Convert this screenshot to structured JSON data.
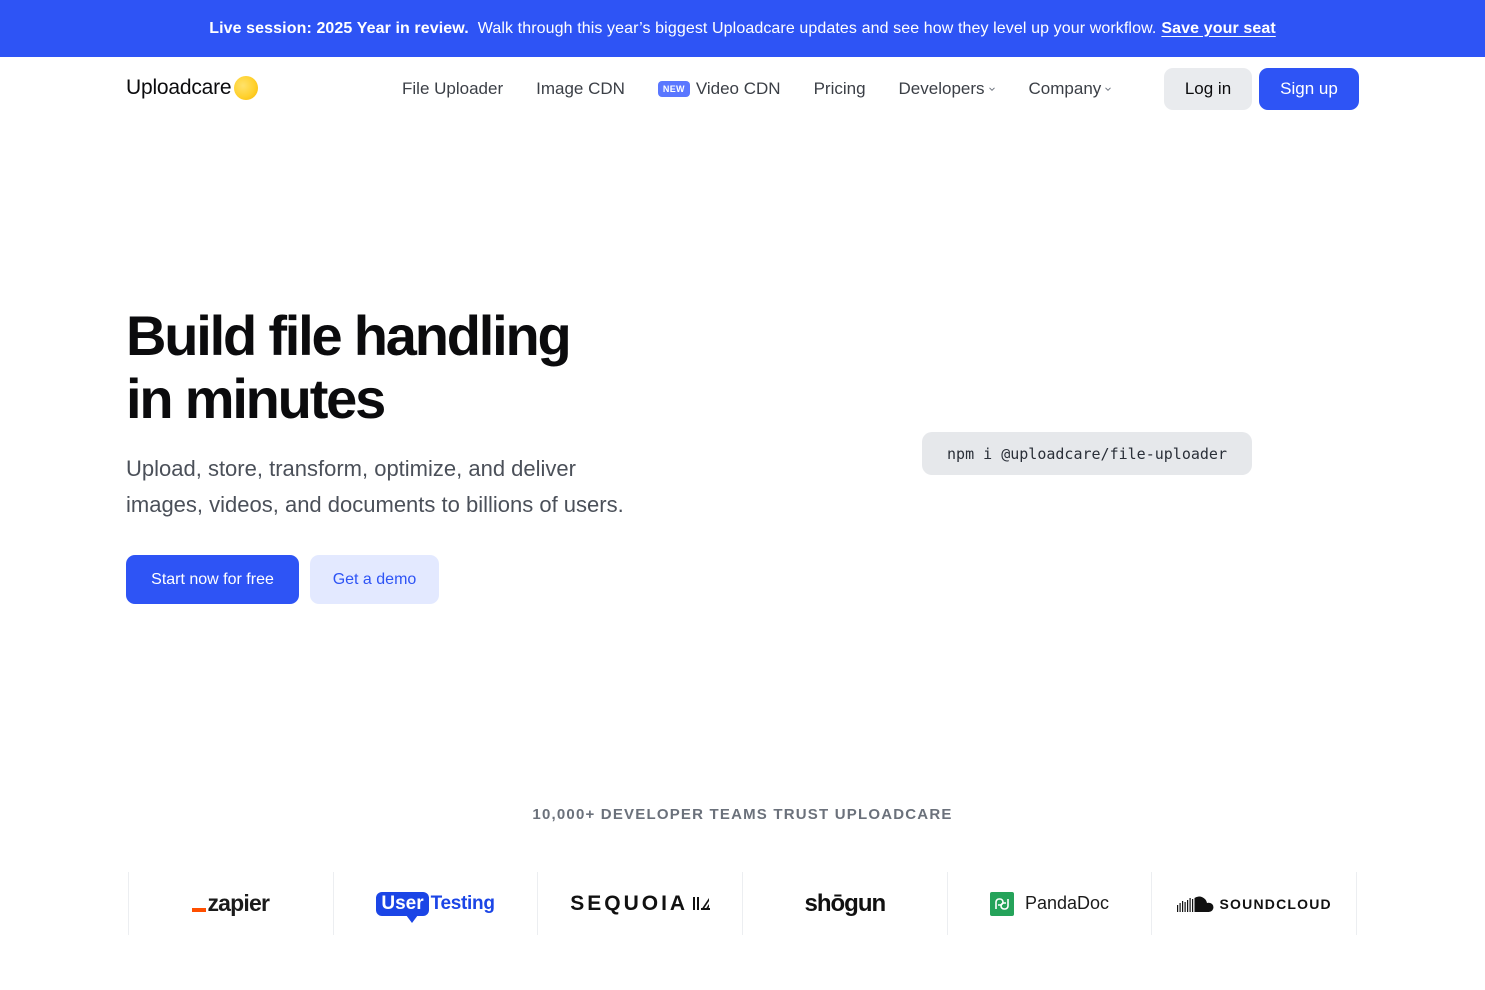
{
  "banner": {
    "strong": "Live session: 2025 Year in review.",
    "description": "Walk through this year’s biggest Uploadcare updates and see how they level up your workflow.",
    "link": "Save your seat"
  },
  "nav": {
    "logo_text": "Uploadcare",
    "links": [
      {
        "label": "File Uploader"
      },
      {
        "label": "Image CDN"
      },
      {
        "label": "Video CDN",
        "badge": "NEW"
      },
      {
        "label": "Pricing"
      },
      {
        "label": "Developers",
        "dropdown": true
      },
      {
        "label": "Company",
        "dropdown": true
      }
    ],
    "login": "Log in",
    "signup": "Sign up"
  },
  "hero": {
    "title_line1": "Build file handling",
    "title_line2": "in minutes",
    "subtitle_line1": "Upload, store, transform, optimize, and deliver",
    "subtitle_line2": "images, videos, and documents to billions of users.",
    "primary_cta": "Start now for free",
    "secondary_cta": "Get a demo",
    "npm_command": "npm i @uploadcare/file-uploader"
  },
  "trust": {
    "heading": "10,000+ DEVELOPER TEAMS TRUST UPLOADCARE",
    "logos": {
      "zapier": "zapier",
      "usertesting_pill": "User",
      "usertesting_text": "Testing",
      "sequoia": "SEQUOIA",
      "shogun": "shōgun",
      "pandadoc": "PandaDoc",
      "soundcloud": "SOUNDCLOUD"
    }
  },
  "colors": {
    "accent": "#2e54f5",
    "banner_bg": "#2e54f5",
    "logo_dot": "#ffd12e",
    "zapier_orange": "#ff4f00",
    "usertesting_blue": "#1b45e6",
    "pandadoc_green": "#25a35a"
  },
  "icons": {
    "logo_mark": "yellow-circle",
    "dropdown": "chevron-down-icon",
    "soundcloud": "soundcloud-cloud-icon",
    "sequoia": "sequoia-mark-icon",
    "pandadoc": "pandadoc-mark-icon"
  }
}
